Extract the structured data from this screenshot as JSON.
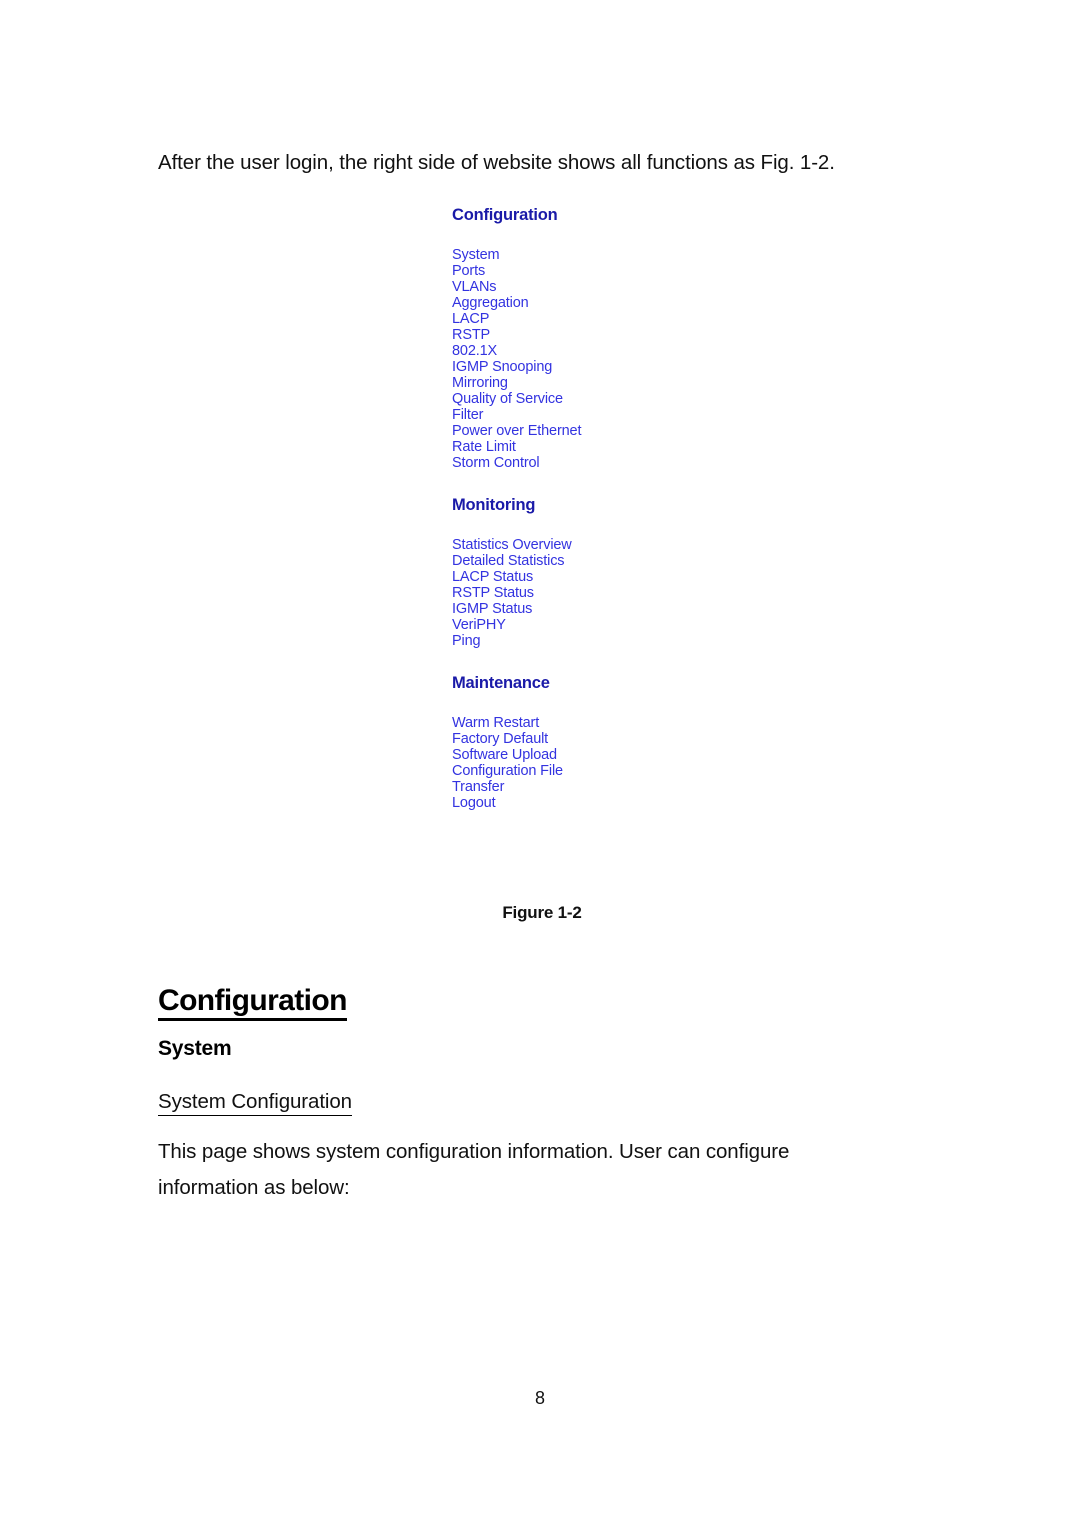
{
  "document": {
    "intro_text": "After the user login, the right side of website shows all functions as Fig. 1-2.",
    "page_number": "8"
  },
  "figure": {
    "caption": "Figure 1-2",
    "sections": [
      {
        "heading": "Configuration",
        "items": [
          "System",
          "Ports",
          "VLANs",
          "Aggregation",
          "LACP",
          "RSTP",
          "802.1X",
          "IGMP Snooping",
          "Mirroring",
          "Quality of Service",
          "Filter",
          "Power over Ethernet",
          "Rate Limit",
          "Storm Control"
        ]
      },
      {
        "heading": "Monitoring",
        "items": [
          "Statistics Overview",
          "Detailed Statistics",
          "LACP Status",
          "RSTP Status",
          "IGMP Status",
          "VeriPHY",
          "Ping"
        ]
      },
      {
        "heading": "Maintenance",
        "items": [
          "Warm Restart",
          "Factory Default",
          "Software Upload",
          "Configuration File",
          "Transfer",
          "Logout"
        ]
      }
    ]
  },
  "body": {
    "heading_configuration": "Configuration",
    "heading_system": "System",
    "heading_system_configuration": "System Configuration",
    "paragraph": "This page shows system configuration information. User can configure information as below:"
  },
  "colors": {
    "menu_heading": "#1a1aa8",
    "menu_link": "#3333e0",
    "text": "#111111"
  }
}
